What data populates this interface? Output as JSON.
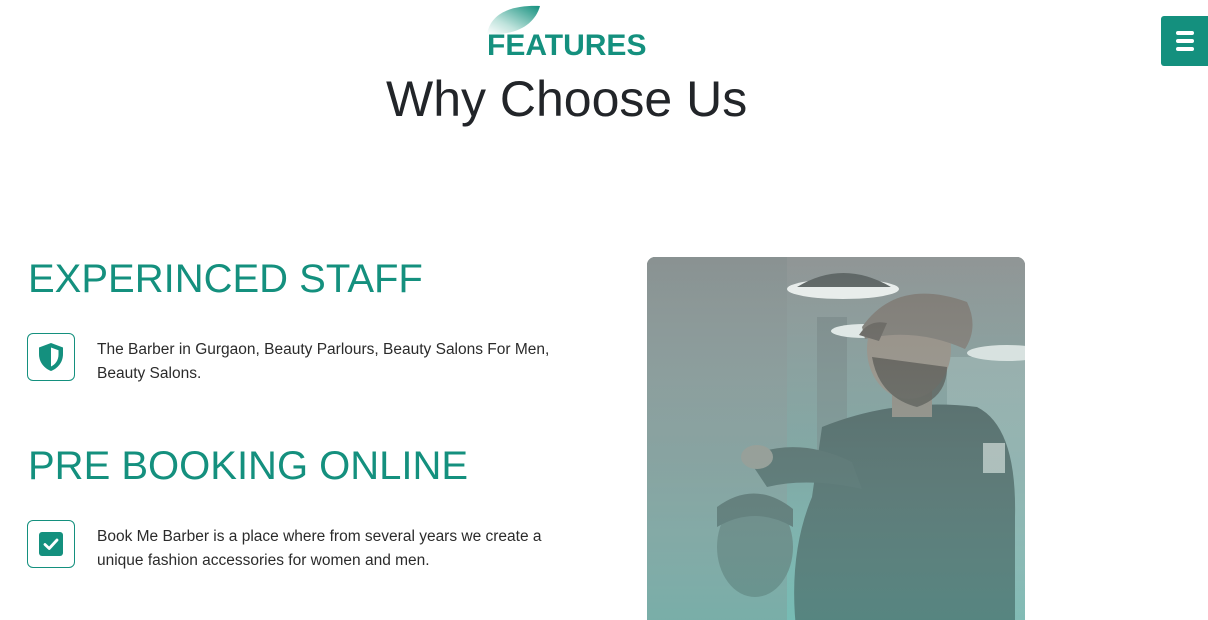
{
  "header": {
    "eyebrow": "FEATURES",
    "title": "Why Choose Us",
    "leaf_icon": "leaf-icon",
    "menu_icon": "hamburger-menu-icon"
  },
  "features": [
    {
      "title": "EXPERINCED STAFF",
      "icon": "shield-icon",
      "text": "The Barber in Gurgaon, Beauty Parlours, Beauty Salons For Men, Beauty Salons."
    },
    {
      "title": "PRE BOOKING ONLINE",
      "icon": "checkbox-icon",
      "text": "Book Me Barber is a place where from several years we create a unique fashion accessories for women and men."
    }
  ],
  "colors": {
    "accent": "#14907e",
    "title_text": "#222529",
    "body_text": "#2b2b2b"
  }
}
